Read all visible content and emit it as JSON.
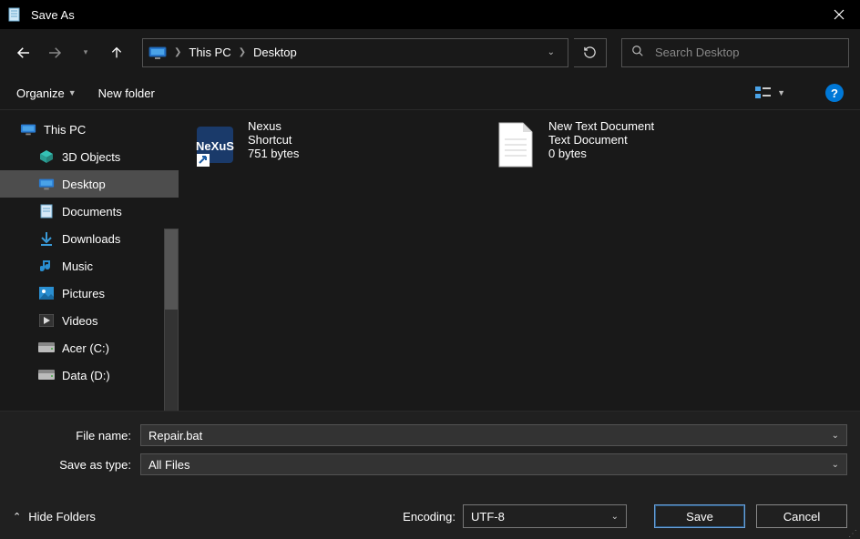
{
  "window": {
    "title": "Save As"
  },
  "breadcrumb": {
    "root": "This PC",
    "current": "Desktop"
  },
  "search": {
    "placeholder": "Search Desktop"
  },
  "toolbar": {
    "organize": "Organize",
    "new_folder": "New folder"
  },
  "sidebar": {
    "root": "This PC",
    "items": [
      {
        "label": "3D Objects"
      },
      {
        "label": "Desktop"
      },
      {
        "label": "Documents"
      },
      {
        "label": "Downloads"
      },
      {
        "label": "Music"
      },
      {
        "label": "Pictures"
      },
      {
        "label": "Videos"
      },
      {
        "label": "Acer (C:)"
      },
      {
        "label": "Data (D:)"
      }
    ],
    "selected_index": 1
  },
  "files": [
    {
      "name": "Nexus",
      "type": "Shortcut",
      "size": "751 bytes"
    },
    {
      "name": "New Text Document",
      "type": "Text Document",
      "size": "0 bytes"
    }
  ],
  "form": {
    "file_name_label": "File name:",
    "file_name_value": "Repair.bat",
    "save_as_type_label": "Save as type:",
    "save_as_type_value": "All Files",
    "encoding_label": "Encoding:",
    "encoding_value": "UTF-8",
    "hide_folders": "Hide Folders",
    "save": "Save",
    "cancel": "Cancel"
  }
}
